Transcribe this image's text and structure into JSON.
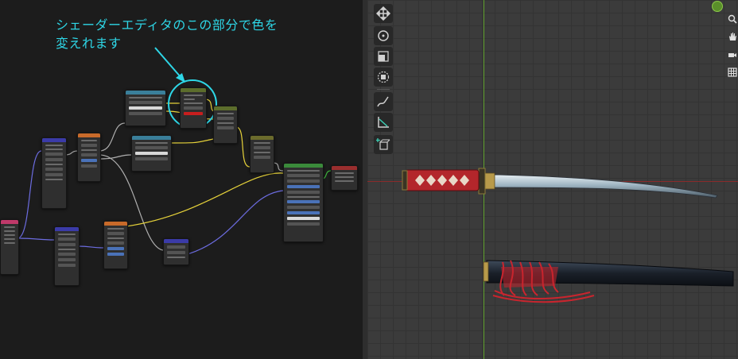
{
  "annotation": {
    "line1": "シェーダーエディタのこの部分で色を",
    "line2": "変えれます"
  },
  "colors": {
    "annotation_cyan": "#2ed6e6",
    "axis_red": "#8a2b2b",
    "axis_green": "#5d9e2a",
    "handle_wrap": "#b3262b",
    "scabbard_cord": "#c9252e",
    "blade": "#8fa6b4"
  },
  "toolbar": {
    "tools": [
      "move-icon",
      "rotate-icon",
      "scale-icon",
      "transform-icon",
      "annotate-icon",
      "measure-icon",
      "add-cube-icon"
    ]
  },
  "nav_gizmo": {
    "buttons": [
      "zoom-icon",
      "pan-hand-icon",
      "camera-icon",
      "grid-icon"
    ]
  }
}
